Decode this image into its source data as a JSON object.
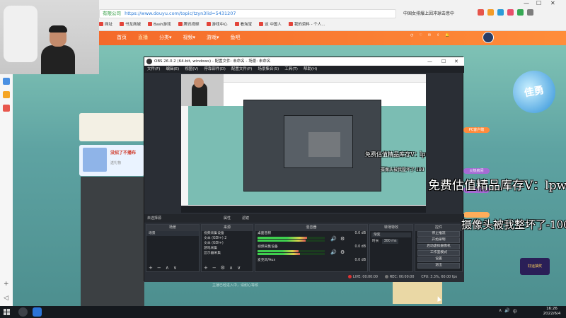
{
  "browser": {
    "url_prefix": "https://",
    "url": "https://www.douyu.com/topic/tzyn3lid=5431207",
    "secure_label": "有限公司",
    "right_hint": "中国女排爆上因冲球击意中",
    "bookmarks": [
      "网址",
      "书龙商城",
      "Bash游戏",
      "腾讯视频",
      "游戏中心",
      "看淘宝",
      "这 中国人",
      "我的资料 - 个人..."
    ],
    "window_controls": [
      "—",
      "☐",
      "✕"
    ]
  },
  "site": {
    "nav": [
      "首页",
      "直播",
      "分类▾",
      "视频▾",
      "游戏▾",
      "鱼吧"
    ],
    "active_nav": "直播"
  },
  "webcam": {},
  "overlay": {
    "line1": "免费估值精品库存V：lpwy02",
    "line2": "摄像头被我整坏了-100",
    "small1": "免费估值精品库存V：lpwy02",
    "small2": "摄像头被我整坏了-100"
  },
  "left_panel": {
    "banner_text": "没招了不播布",
    "banner_sub": "送礼物"
  },
  "right_panel": {
    "tag1": "PC客户端",
    "tag2": "火热房间",
    "badge": "好运抽奖"
  },
  "obs": {
    "title": "OBS 26.0.2 (64-bit, windows) - 配置文件: 未命名 - 场景: 未命名",
    "menu": [
      "文件(F)",
      "编辑(E)",
      "视图(V)",
      "停靠部件(D)",
      "配置文件(P)",
      "场景集合(S)",
      "工具(T)",
      "帮助(H)"
    ],
    "scene_bar_label": "未选择源",
    "scene_bar_tabs": [
      "属性",
      "滤镜"
    ],
    "docks": {
      "scenes": {
        "title": "场景",
        "items": [
          "场景"
        ]
      },
      "sources": {
        "title": "来源",
        "items": [
          "视频采集设备",
          "文本 (GDI+) 2",
          "文本 (GDI+)",
          "游戏采集",
          "显示器采集"
        ]
      },
      "mixer": {
        "title": "混音器",
        "tracks": [
          {
            "name": "桌面音频",
            "db": "0.0 dB"
          },
          {
            "name": "视频采集设备",
            "db": "0.0 dB"
          },
          {
            "name": "麦克风/Aux",
            "db": "0.0 dB"
          }
        ]
      },
      "transitions": {
        "title": "转场特效",
        "type": "渐变",
        "duration_label": "时长",
        "duration": "300 ms"
      },
      "controls": {
        "title": "控件",
        "buttons": [
          "停止推流",
          "开始录制",
          "启动虚拟摄像机",
          "工作室模式",
          "设置",
          "退出"
        ]
      }
    },
    "status": {
      "live": "LIVE: 00:00:00",
      "rec": "REC: 00:00:00",
      "cpu": "CPU: 3.3%, 60.00 fps"
    },
    "foot_buttons": [
      "+",
      "−",
      "∧",
      "∨"
    ]
  },
  "below_text": "主播已经进入中，请耐心等候",
  "taskbar": {
    "time": "16:26",
    "date": "2022/6/4",
    "tray": [
      "∧",
      "🔊",
      "中"
    ]
  },
  "colors": {
    "accent_orange": "#ff7c3a",
    "stream_bg": "#5fa8a8",
    "obs_dark": "#2a2e35"
  }
}
